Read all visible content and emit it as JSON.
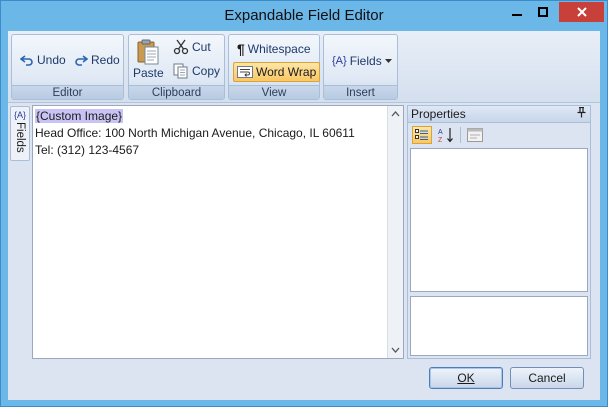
{
  "window": {
    "title": "Expandable Field Editor",
    "minimize_label": "minimize",
    "maximize_label": "maximize",
    "close_label": "close"
  },
  "ribbon": {
    "editor_group": {
      "label": "Editor",
      "undo": "Undo",
      "redo": "Redo"
    },
    "clipboard_group": {
      "label": "Clipboard",
      "paste": "Paste",
      "cut": "Cut",
      "copy": "Copy"
    },
    "view_group": {
      "label": "View",
      "whitespace": "Whitespace",
      "word_wrap": "Word Wrap",
      "word_wrap_active": true
    },
    "insert_group": {
      "label": "Insert",
      "fields": "Fields"
    }
  },
  "side_tab": {
    "icon_text": "{A}",
    "label": "Fields"
  },
  "editor": {
    "lines": [
      {
        "token": "{Custom Image}"
      },
      {
        "text": "Head Office: 100 North Michigan Avenue, Chicago, IL 60611"
      },
      {
        "text": "Tel: (312) 123-4567"
      }
    ]
  },
  "properties": {
    "title": "Properties"
  },
  "buttons": {
    "ok": "OK",
    "cancel": "Cancel"
  },
  "colors": {
    "title_bar": "#6bb7e8",
    "close_button": "#c7403a",
    "active_button": "#f9c765",
    "field_token_highlight": "#c9c3f5"
  }
}
